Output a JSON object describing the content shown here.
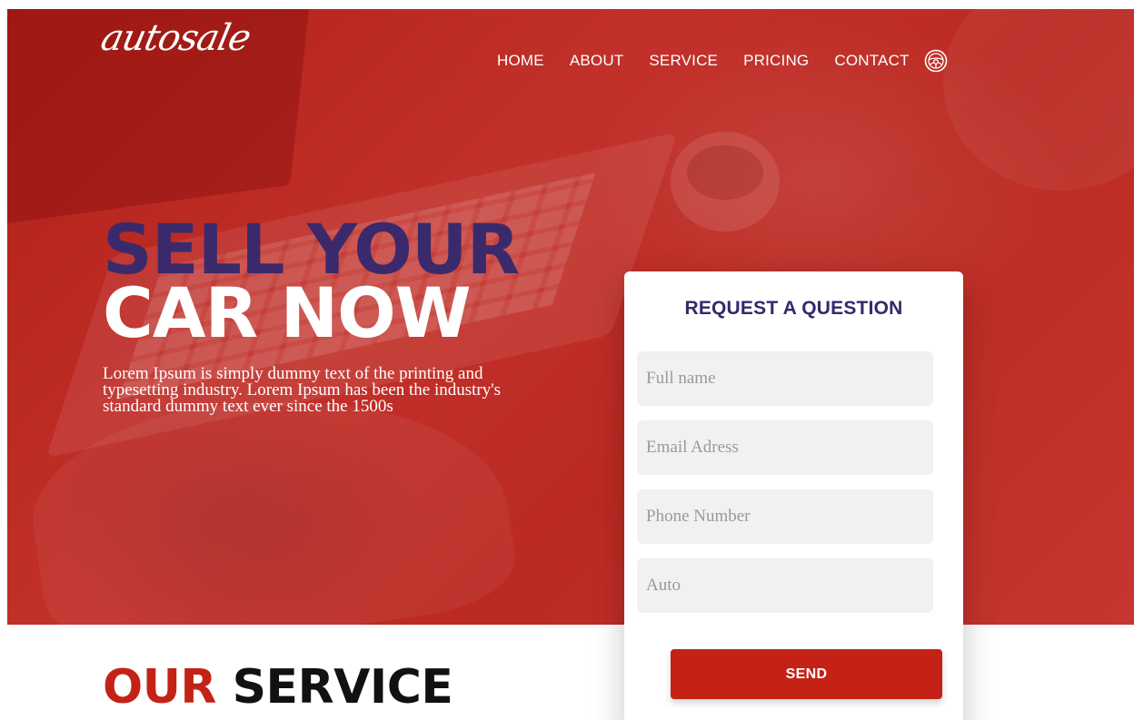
{
  "brand": {
    "logo_text": "autosale"
  },
  "nav": {
    "items": [
      "HOME",
      "ABOUT",
      "SERVICE",
      "PRICING",
      "CONTACT"
    ],
    "icon": "steering-wheel-icon"
  },
  "hero": {
    "headline_line1": "SELL YOUR",
    "headline_line2": "CAR NOW",
    "description": "Lorem Ipsum is simply dummy text of the printing and typesetting industry. Lorem Ipsum has been the industry's standard dummy text ever since the 1500s"
  },
  "form": {
    "title": "REQUEST A QUESTION",
    "fields": [
      {
        "placeholder": "Full name",
        "value": ""
      },
      {
        "placeholder": "Email Adress",
        "value": ""
      },
      {
        "placeholder": "Phone Number",
        "value": ""
      },
      {
        "placeholder": "Auto",
        "value": ""
      }
    ],
    "submit_label": "SEND"
  },
  "service": {
    "title_accent": "OUR",
    "title_rest": "SERVICE"
  },
  "colors": {
    "hero_red": "#bb2a22",
    "accent_red": "#c42216",
    "headline_purple": "#3b2a6b",
    "card_title": "#33296b"
  }
}
